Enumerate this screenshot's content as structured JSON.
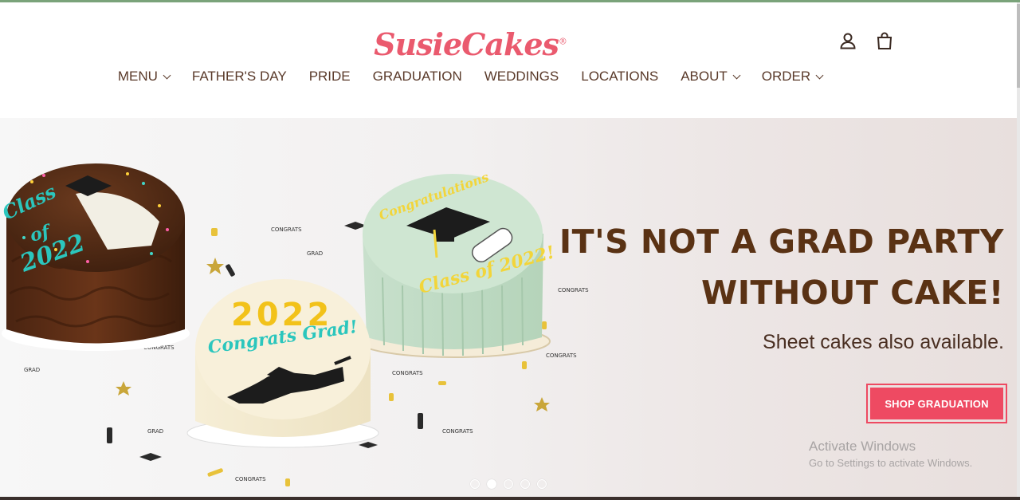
{
  "brand": {
    "name": "SusieCakes",
    "reg_mark": "®",
    "color": "#ea5a6e"
  },
  "header_icons": {
    "account": "user-icon",
    "cart": "shopping-bag-icon"
  },
  "nav": [
    {
      "label": "MENU",
      "dropdown": true
    },
    {
      "label": "FATHER'S DAY",
      "dropdown": false
    },
    {
      "label": "PRIDE",
      "dropdown": false
    },
    {
      "label": "GRADUATION",
      "dropdown": false
    },
    {
      "label": "WEDDINGS",
      "dropdown": false
    },
    {
      "label": "LOCATIONS",
      "dropdown": false
    },
    {
      "label": "ABOUT",
      "dropdown": true
    },
    {
      "label": "ORDER",
      "dropdown": true
    }
  ],
  "hero": {
    "headline_line1": "IT'S NOT A GRAD PARTY",
    "headline_line2": "WITHOUT CAKE!",
    "subline": "Sheet cakes also available.",
    "cta_label": "SHOP GRADUATION",
    "cta_color": "#ee4a62",
    "cake_text": {
      "left": [
        "Class",
        "of",
        "2022"
      ],
      "front_year": "2022",
      "front_message": "Congrats Grad!",
      "right_top": "Congratulations",
      "right_bottom": "Class of 2022!"
    },
    "slides": {
      "count": 5,
      "active_index": 1
    }
  },
  "watermark": {
    "line1": "Activate Windows",
    "line2": "Go to Settings to activate Windows."
  }
}
